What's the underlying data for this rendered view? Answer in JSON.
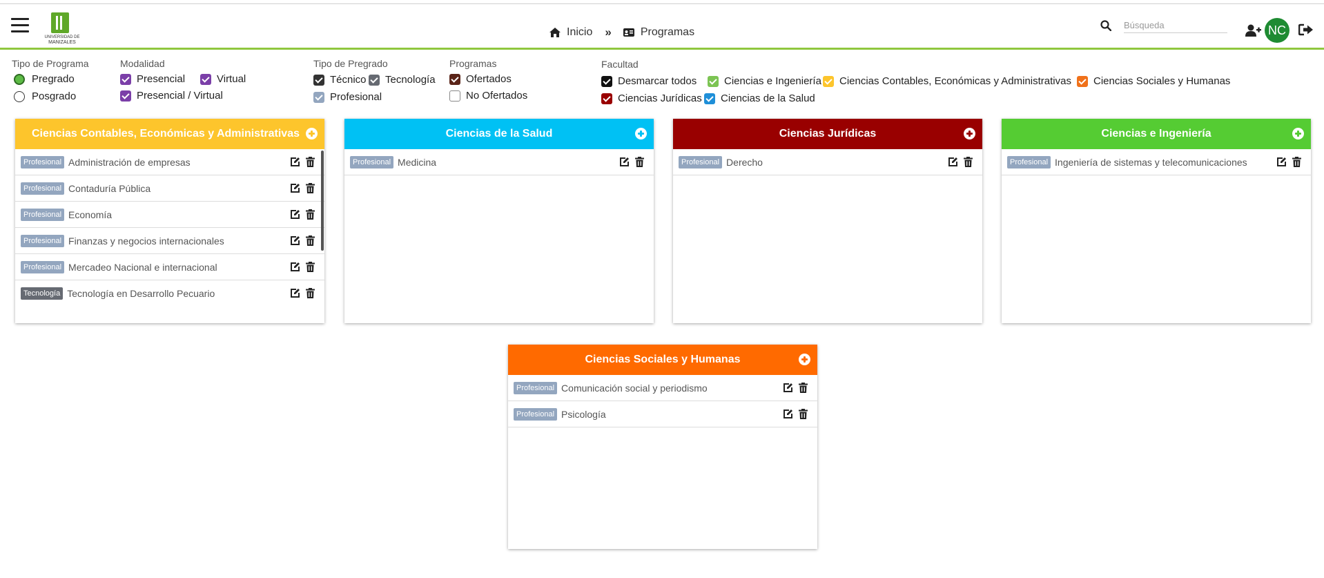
{
  "header": {
    "logo_line1": "UNIVERSIDAD DE",
    "logo_line2": "MANIZALES",
    "breadcrumb": {
      "home": "Inicio",
      "current": "Programas"
    },
    "search_placeholder": "Búsqueda",
    "avatar_initials": "NC"
  },
  "filters": {
    "tipo_programa": {
      "title": "Tipo de Programa",
      "options": [
        "Pregrado",
        "Posgrado"
      ],
      "selected": "Pregrado"
    },
    "modalidad": {
      "title": "Modalidad",
      "options": [
        "Presencial",
        "Virtual",
        "Presencial / Virtual"
      ]
    },
    "tipo_pregrado": {
      "title": "Tipo de Pregrado",
      "options": [
        "Técnico",
        "Tecnología",
        "Profesional"
      ]
    },
    "programas": {
      "title": "Programas",
      "options": [
        "Ofertados",
        "No Ofertados"
      ]
    },
    "facultad": {
      "title": "Facultad",
      "options": [
        "Desmarcar todos",
        "Ciencias e Ingeniería",
        "Ciencias Contables, Económicas y Administrativas",
        "Ciencias Sociales y Humanas",
        "Ciencias Jurídicas",
        "Ciencias de la Salud"
      ]
    }
  },
  "colors": {
    "accent_green": "#8fc73e",
    "contables": "#fdc52c",
    "salud": "#00c1f4",
    "juridicas": "#990000",
    "ingenieria": "#55cc33",
    "sociales": "#ff6a00",
    "modalidad": "#7b3fa8",
    "pregrado": "#444444",
    "profesional": "#93a6bf",
    "ofertados": "#5a2418"
  },
  "cards": [
    {
      "title": "Ciencias Contables, Económicas y Administrativas",
      "programs": [
        {
          "type": "Profesional",
          "name": "Administración de empresas"
        },
        {
          "type": "Profesional",
          "name": "Contaduría Pública"
        },
        {
          "type": "Profesional",
          "name": "Economía"
        },
        {
          "type": "Profesional",
          "name": "Finanzas y negocios internacionales"
        },
        {
          "type": "Profesional",
          "name": "Mercadeo Nacional e internacional"
        },
        {
          "type": "Tecnología",
          "name": "Tecnología en Desarrollo Pecuario"
        }
      ]
    },
    {
      "title": "Ciencias de la Salud",
      "programs": [
        {
          "type": "Profesional",
          "name": "Medicina"
        }
      ]
    },
    {
      "title": "Ciencias Jurídicas",
      "programs": [
        {
          "type": "Profesional",
          "name": "Derecho"
        }
      ]
    },
    {
      "title": "Ciencias e Ingeniería",
      "programs": [
        {
          "type": "Profesional",
          "name": "Ingeniería de sistemas y telecomunicaciones"
        }
      ]
    },
    {
      "title": "Ciencias Sociales y Humanas",
      "programs": [
        {
          "type": "Profesional",
          "name": "Comunicación social y periodismo"
        },
        {
          "type": "Profesional",
          "name": "Psicología"
        }
      ]
    }
  ]
}
